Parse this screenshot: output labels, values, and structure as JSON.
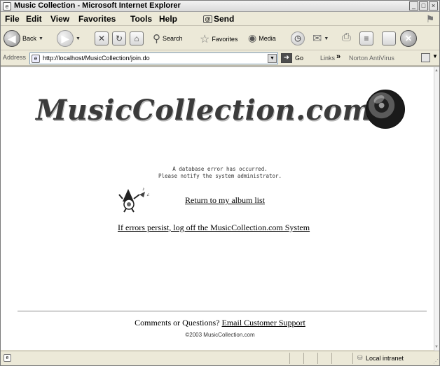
{
  "window": {
    "title": "Music Collection - Microsoft Internet Explorer",
    "controls": [
      "minimize",
      "maximize",
      "close"
    ]
  },
  "menu": {
    "items": [
      "File",
      "Edit",
      "View",
      "Favorites",
      "Tools",
      "Help"
    ],
    "send_label": "Send"
  },
  "toolbar": {
    "back_label": "Back",
    "search_label": "Search",
    "favorites_label": "Favorites",
    "media_label": "Media"
  },
  "address": {
    "label": "Address",
    "url": "http://localhost/MusicCollection/join.do",
    "go_label": "Go",
    "links_label": "Links",
    "toolbar_extra": "Norton AntiVirus"
  },
  "page": {
    "logo_text": "MusicCollection.com",
    "error_line_1": "A database error has occurred.",
    "error_line_2": "Please notify the system administrator.",
    "return_link": "Return to my album list",
    "logoff_link": "If errors persist, log off the MusicCollection.com System",
    "footer_prefix": "Comments or Questions?",
    "footer_link": "Email Customer Support",
    "copyright": "©2003 MusicCollection.com"
  },
  "status": {
    "zone": "Local intranet"
  }
}
